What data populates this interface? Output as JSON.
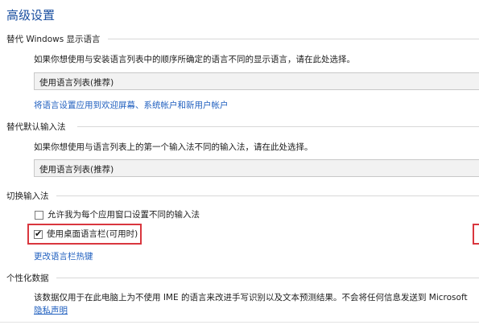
{
  "page_title": "高级设置",
  "display_language": {
    "title": "替代 Windows 显示语言",
    "description": "如果你想使用与安装语言列表中的顺序所确定的语言不同的显示语言，请在此处选择。",
    "dropdown_value": "使用语言列表(推荐)",
    "apply_link": "将语言设置应用到欢迎屏幕、系统帐户和新用户帐户"
  },
  "default_input": {
    "title": "替代默认输入法",
    "description": "如果你想使用与语言列表上的第一个输入法不同的输入法，请在此处选择。",
    "dropdown_value": "使用语言列表(推荐)"
  },
  "switch_input": {
    "title": "切换输入法",
    "per_app_checkbox": {
      "label": "允许我为每个应用窗口设置不同的输入法",
      "checked": false
    },
    "desktop_bar_checkbox": {
      "label": "使用桌面语言栏(可用时)",
      "checked": true
    },
    "hotkey_link": "更改语言栏热键"
  },
  "personalization": {
    "title": "个性化数据",
    "description": "该数据仅用于在此电脑上为不使用 IME 的语言来改进手写识别以及文本预测结果。不会将任何信息发送到 Microsoft",
    "privacy_link": "隐私声明"
  },
  "colors": {
    "accent": "#1a4fa0",
    "link": "#1f5fbf",
    "highlight": "#d9363e"
  }
}
